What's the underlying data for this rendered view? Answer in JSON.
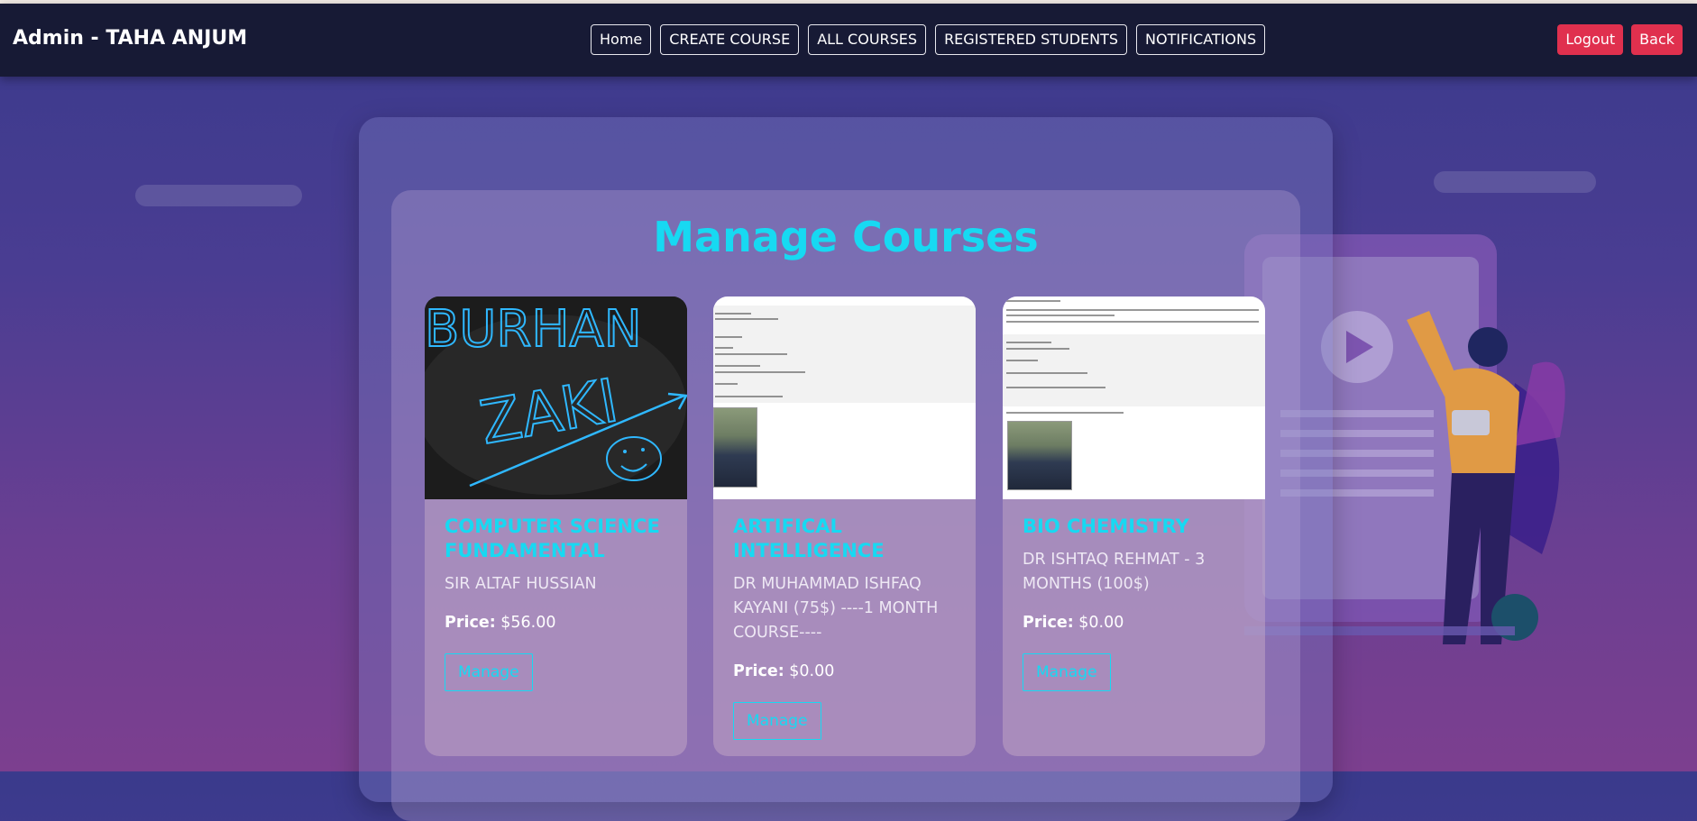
{
  "header": {
    "brand": "Admin - TAHA ANJUM",
    "nav": [
      "Home",
      "CREATE COURSE",
      "ALL COURSES",
      "REGISTERED STUDENTS",
      "NOTIFICATIONS"
    ],
    "logout_label": "Logout",
    "back_label": "Back"
  },
  "page": {
    "title": "Manage Courses"
  },
  "courses": [
    {
      "name": "COMPUTER SCIENCE FUNDAMENTAL",
      "instructor": "SIR ALTAF HUSSIAN",
      "price_label": "Price:",
      "price": "$56.00",
      "manage_label": "Manage",
      "thumbnail_text_1": "BURHAN",
      "thumbnail_text_2": "ZAKI"
    },
    {
      "name": "ARTIFICAL INTELLIGENCE",
      "instructor": "DR MUHAMMAD ISHFAQ KAYANI (75$) ----1 MONTH COURSE----",
      "price_label": "Price:",
      "price": "$0.00",
      "manage_label": "Manage"
    },
    {
      "name": "BIO CHEMISTRY",
      "instructor": "DR ISHTAQ REHMAT - 3 MONTHS (100$)",
      "price_label": "Price:",
      "price": "$0.00",
      "manage_label": "Manage"
    }
  ],
  "colors": {
    "accent": "#17d9f2",
    "danger": "#e0304e",
    "header_bg": "#171a35"
  }
}
